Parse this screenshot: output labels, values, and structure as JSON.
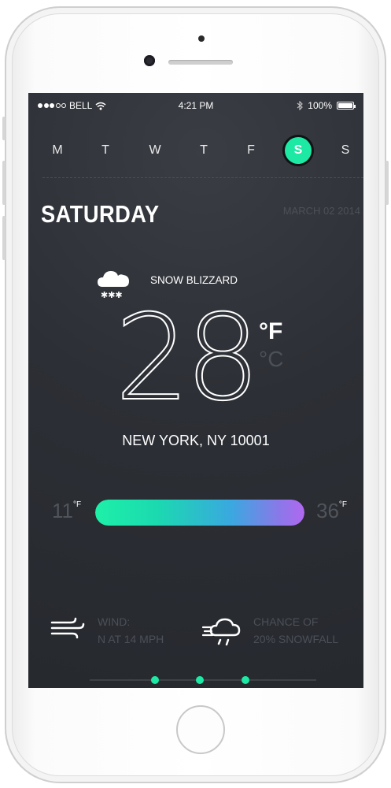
{
  "status_bar": {
    "carrier": "BELL",
    "time": "4:21 PM",
    "battery_percent": "100%",
    "icons": [
      "signal-dots-icon",
      "wifi-icon",
      "bluetooth-icon",
      "battery-icon"
    ]
  },
  "days": {
    "items": [
      "M",
      "T",
      "W",
      "T",
      "F",
      "S",
      "S"
    ],
    "selected_index": 5,
    "accent_color": "#1de9a5"
  },
  "header": {
    "day_name": "SATURDAY",
    "date": "MARCH 02 2014"
  },
  "weather": {
    "condition_icon": "snow-cloud-icon",
    "condition": "SNOW BLIZZARD",
    "temperature": "28",
    "unit_f": "°F",
    "unit_c": "°C",
    "location": "NEW YORK, NY 10001"
  },
  "range": {
    "low": "11",
    "high": "36",
    "unit": "°F",
    "gradient_colors": [
      "#1ef0a8",
      "#3aa8e0",
      "#b168f0"
    ]
  },
  "details": {
    "wind": {
      "icon": "wind-icon",
      "line1": "WIND:",
      "line2": "N AT 14 MPH"
    },
    "snow": {
      "icon": "rain-cloud-icon",
      "line1": "CHANCE OF",
      "line2": "20% SNOWFALL"
    }
  },
  "pager": {
    "pages": 3
  }
}
